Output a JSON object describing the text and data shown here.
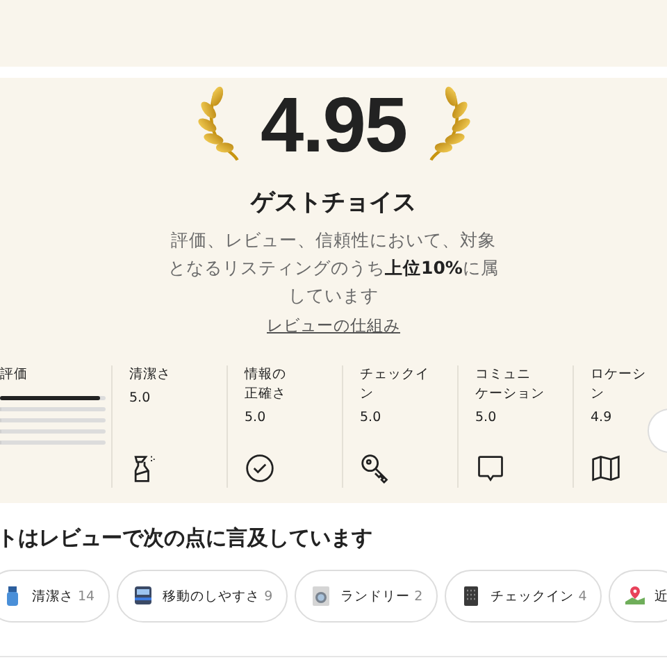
{
  "rating": {
    "score": "4.95",
    "title": "ゲストチョイス",
    "description": "評価、レビュー、信頼性において、対象となるリスティングのうち**上位10%**に属しています",
    "link": "レビューの仕組み"
  },
  "overall": {
    "label": "評価",
    "bars": [
      {
        "level": 0.95
      },
      {
        "level": 0
      },
      {
        "level": 0
      },
      {
        "level": 0
      },
      {
        "level": 0
      }
    ]
  },
  "categories": [
    {
      "lines": [
        "清潔さ"
      ],
      "value": "5.0"
    },
    {
      "lines": [
        "情報の",
        "正確さ"
      ],
      "value": "5.0"
    },
    {
      "lines": [
        "チェックイ",
        "ン"
      ],
      "value": "5.0"
    },
    {
      "lines": [
        "コミュニ",
        "ケーション"
      ],
      "value": "5.0"
    },
    {
      "lines": [
        "ロケーシ",
        "ン"
      ],
      "value": "4.9"
    }
  ],
  "mentions": {
    "heading": "トはレビューで次の点に言及しています",
    "chips": [
      {
        "label": "清潔さ",
        "count": "14"
      },
      {
        "label": "移動のしやすさ",
        "count": "9"
      },
      {
        "label": "ランドリー",
        "count": "2"
      },
      {
        "label": "チェックイン",
        "count": "4"
      },
      {
        "label": "近"
      }
    ]
  }
}
